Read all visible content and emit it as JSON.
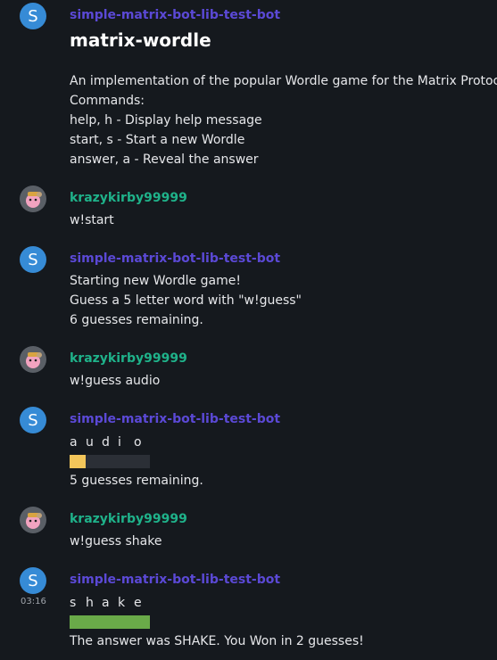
{
  "messages": [
    {
      "sender": "simple-matrix-bot-lib-test-bot",
      "avatar_letter": "S",
      "heading": "matrix-wordle",
      "lines": [
        "An implementation of the popular Wordle game for the Matrix Protocol.",
        "Commands:",
        "help, h - Display help message",
        "start, s - Start a new Wordle",
        "answer, a - Reveal the answer"
      ]
    },
    {
      "sender": "krazykirby99999",
      "lines": [
        "w!start"
      ]
    },
    {
      "sender": "simple-matrix-bot-lib-test-bot",
      "avatar_letter": "S",
      "lines": [
        "Starting new Wordle game!",
        "Guess a 5 letter word with \"w!guess\"",
        "6 guesses remaining."
      ]
    },
    {
      "sender": "krazykirby99999",
      "lines": [
        "w!guess audio"
      ]
    },
    {
      "sender": "simple-matrix-bot-lib-test-bot",
      "avatar_letter": "S",
      "guess_letters": [
        "a",
        "u",
        "d",
        "i",
        "o"
      ],
      "guess_result": [
        "yellow",
        "gray",
        "gray",
        "gray",
        "gray"
      ],
      "after": "5 guesses remaining."
    },
    {
      "sender": "krazykirby99999",
      "lines": [
        "w!guess shake"
      ]
    },
    {
      "sender": "simple-matrix-bot-lib-test-bot",
      "avatar_letter": "S",
      "timestamp": "03:16",
      "guess_letters": [
        "s",
        "h",
        "a",
        "k",
        "e"
      ],
      "guess_result": [
        "green",
        "green",
        "green",
        "green",
        "green"
      ],
      "after": "The answer was SHAKE. You Won in 2 guesses!"
    }
  ],
  "colors": {
    "bot_name": "#5b49d6",
    "user_name": "#1fb28a",
    "avatar_bg": "#368bd6",
    "tile_yellow": "#f3c65a",
    "tile_green": "#6aaa49",
    "tile_gray": "#2b2f36"
  }
}
